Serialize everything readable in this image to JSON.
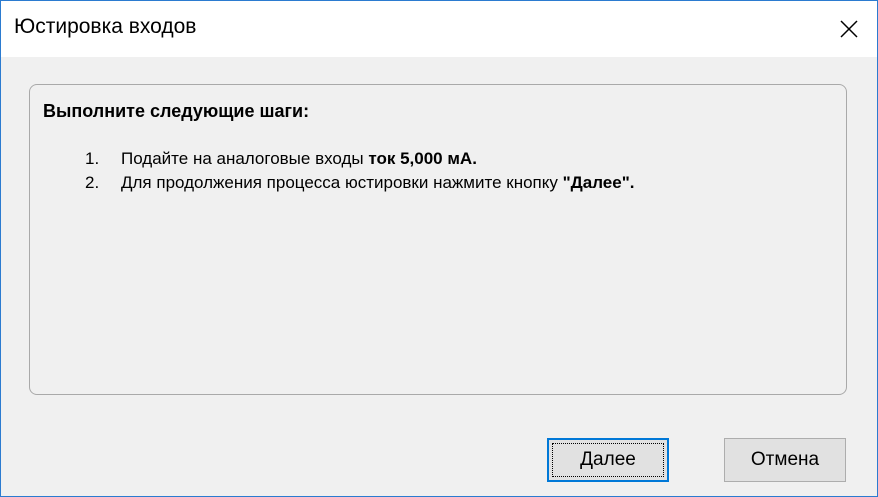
{
  "window": {
    "title": "Юстировка входов"
  },
  "panel": {
    "heading": "Выполните следующие шаги:",
    "steps": [
      {
        "num": "1.",
        "text": "Подайте на аналоговые входы ",
        "bold": "ток 5,000 мА",
        "after": "."
      },
      {
        "num": "2.",
        "text": "Для продолжения процесса юстировки нажмите кнопку ",
        "bold": "\"Далее\"",
        "after": "."
      }
    ]
  },
  "buttons": {
    "next_label": "Далее",
    "cancel_label": "Отмена"
  },
  "colors": {
    "accent": "#0078d7",
    "window_border": "#2b7bd0",
    "background": "#f0f0f0"
  },
  "icons": {
    "close": "close-icon"
  }
}
